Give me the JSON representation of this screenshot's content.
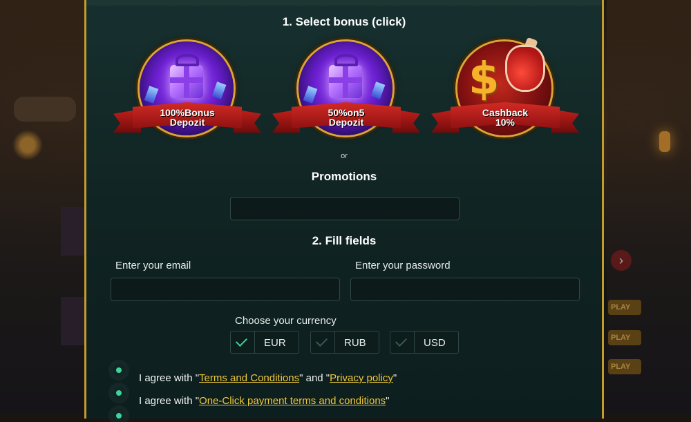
{
  "step1": {
    "title": "1. Select bonus (click)",
    "bonuses": [
      {
        "line1": "100%Bonus",
        "line2": "Depozit",
        "icon": "gift-icon"
      },
      {
        "line1": "50%on5",
        "line2": "Depozit",
        "icon": "gift-icon"
      },
      {
        "line1": "Cashback",
        "line2": "10%",
        "icon": "dollar-potion-icon"
      }
    ],
    "or_text": "or",
    "promotions_title": "Promotions",
    "promo_value": ""
  },
  "step2": {
    "title": "2. Fill fields",
    "email_label": "Enter your email",
    "email_value": "",
    "password_label": "Enter your password",
    "password_value": "",
    "currency_label": "Choose your currency",
    "currencies": [
      {
        "code": "EUR",
        "selected": true
      },
      {
        "code": "RUB",
        "selected": false
      },
      {
        "code": "USD",
        "selected": false
      }
    ]
  },
  "agreements": {
    "agree1_prefix": "I agree with \"",
    "terms_link": "Terms and Conditions",
    "agree1_mid": "\" and \"",
    "privacy_link": "Privacy policy",
    "agree1_suffix": "\"",
    "agree2_prefix": "I agree with \"",
    "oneclick_link": "One-Click payment terms and conditions",
    "agree2_suffix": "\""
  },
  "background": {
    "play_label": "PLAY"
  },
  "colors": {
    "accent_green": "#3fd49a",
    "link_yellow": "#f0c93a",
    "frame_gold": "#c79a2e",
    "panel_bg": "#102423"
  }
}
